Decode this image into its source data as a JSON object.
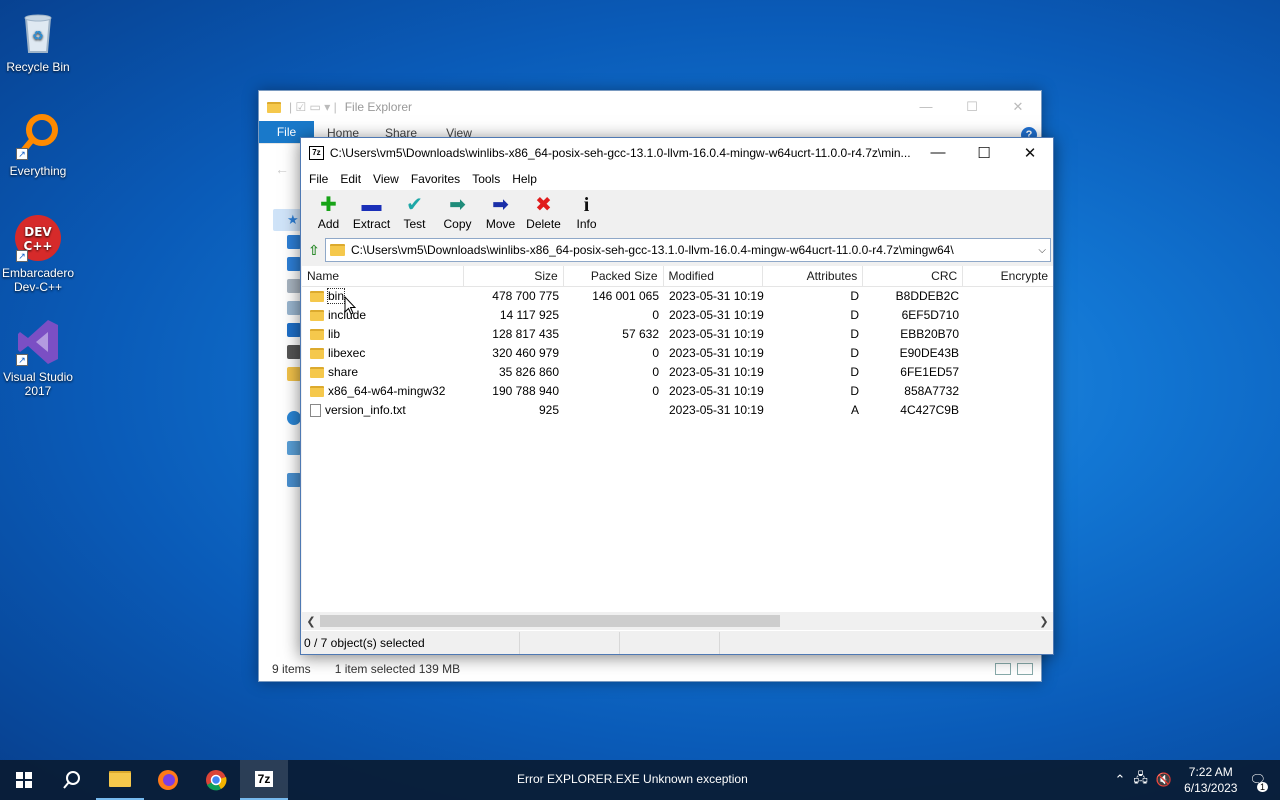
{
  "desktop": {
    "icons": [
      {
        "label": "Recycle Bin"
      },
      {
        "label": "Everything"
      },
      {
        "label": "Embarcadero Dev-C++"
      },
      {
        "label": "Visual Studio 2017"
      }
    ]
  },
  "explorer": {
    "title": "File Explorer",
    "ribbon": {
      "file": "File",
      "home": "Home",
      "share": "Share",
      "view": "View"
    },
    "status": {
      "items": "9 items",
      "selected": "1 item selected  139 MB"
    }
  },
  "sevenzip": {
    "title": "C:\\Users\\vm5\\Downloads\\winlibs-x86_64-posix-seh-gcc-13.1.0-llvm-16.0.4-mingw-w64ucrt-11.0.0-r4.7z\\min...",
    "menu": [
      "File",
      "Edit",
      "View",
      "Favorites",
      "Tools",
      "Help"
    ],
    "toolbar": {
      "add": "Add",
      "extract": "Extract",
      "test": "Test",
      "copy": "Copy",
      "move": "Move",
      "delete": "Delete",
      "info": "Info"
    },
    "address": "C:\\Users\\vm5\\Downloads\\winlibs-x86_64-posix-seh-gcc-13.1.0-llvm-16.0.4-mingw-w64ucrt-11.0.0-r4.7z\\mingw64\\",
    "columns": {
      "name": "Name",
      "size": "Size",
      "packed": "Packed Size",
      "modified": "Modified",
      "attributes": "Attributes",
      "crc": "CRC",
      "encrypted": "Encrypte"
    },
    "rows": [
      {
        "name": "bin",
        "size": "478 700 775",
        "packed": "146 001 065",
        "modified": "2023-05-31 10:19",
        "attr": "D",
        "crc": "B8DDEB2C",
        "type": "folder"
      },
      {
        "name": "include",
        "size": "14 117 925",
        "packed": "0",
        "modified": "2023-05-31 10:19",
        "attr": "D",
        "crc": "6EF5D710",
        "type": "folder"
      },
      {
        "name": "lib",
        "size": "128 817 435",
        "packed": "57 632",
        "modified": "2023-05-31 10:19",
        "attr": "D",
        "crc": "EBB20B70",
        "type": "folder"
      },
      {
        "name": "libexec",
        "size": "320 460 979",
        "packed": "0",
        "modified": "2023-05-31 10:19",
        "attr": "D",
        "crc": "E90DE43B",
        "type": "folder"
      },
      {
        "name": "share",
        "size": "35 826 860",
        "packed": "0",
        "modified": "2023-05-31 10:19",
        "attr": "D",
        "crc": "6FE1ED57",
        "type": "folder"
      },
      {
        "name": "x86_64-w64-mingw32",
        "size": "190 788 940",
        "packed": "0",
        "modified": "2023-05-31 10:19",
        "attr": "D",
        "crc": "858A7732",
        "type": "folder"
      },
      {
        "name": "version_info.txt",
        "size": "925",
        "packed": "",
        "modified": "2023-05-31 10:19",
        "attr": "A",
        "crc": "4C427C9B",
        "type": "file"
      }
    ],
    "status": "0 / 7 object(s) selected"
  },
  "taskbar": {
    "message": "Error EXPLORER.EXE Unknown exception",
    "time": "7:22 AM",
    "date": "6/13/2023",
    "notifications": "1",
    "active_app_label": "7z"
  }
}
